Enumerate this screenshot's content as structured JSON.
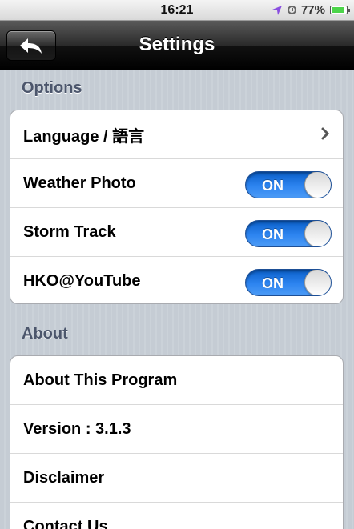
{
  "status_bar": {
    "time": "16:21",
    "battery_percent": "77%",
    "icons": [
      "location-arrow-icon",
      "clock-icon",
      "battery-icon"
    ]
  },
  "nav": {
    "title": "Settings",
    "back_icon": "back-arrow-icon"
  },
  "options": {
    "header": "Options",
    "rows": [
      {
        "label": "Language / 語言",
        "accessory": "chevron-right-icon"
      },
      {
        "label": "Weather Photo",
        "toggle": "ON"
      },
      {
        "label": "Storm Track",
        "toggle": "ON"
      },
      {
        "label": "HKO@YouTube",
        "toggle": "ON"
      }
    ]
  },
  "about": {
    "header": "About",
    "rows": [
      {
        "label": "About This Program"
      },
      {
        "label": "Version : 3.1.3"
      },
      {
        "label": "Disclaimer"
      },
      {
        "label": "Contact Us"
      }
    ]
  },
  "colors": {
    "toggle_on": "#2d84f0",
    "section_header": "#4c566c",
    "background": "#c5ccd4",
    "location_icon": "#8a4fe0"
  }
}
